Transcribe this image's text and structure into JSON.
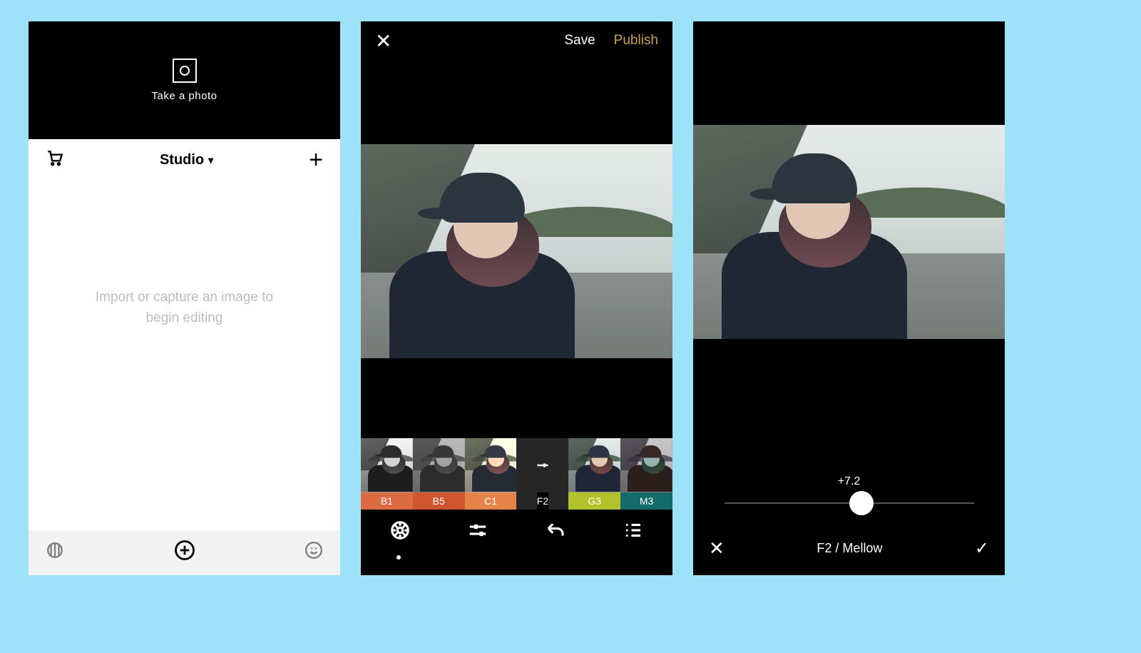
{
  "phone1": {
    "camera_label": "Take a photo",
    "studio_title": "Studio",
    "body_text": "Import or capture an image to begin editing"
  },
  "phone2": {
    "save": "Save",
    "publish": "Publish",
    "filters": [
      {
        "code": "B1"
      },
      {
        "code": "B5"
      },
      {
        "code": "C1"
      },
      {
        "code": "F2"
      },
      {
        "code": "G3"
      },
      {
        "code": "M3"
      }
    ]
  },
  "phone3": {
    "slider_value": "+7.2",
    "slider_position_percent": 55,
    "filter_title": "F2 / Mellow"
  }
}
